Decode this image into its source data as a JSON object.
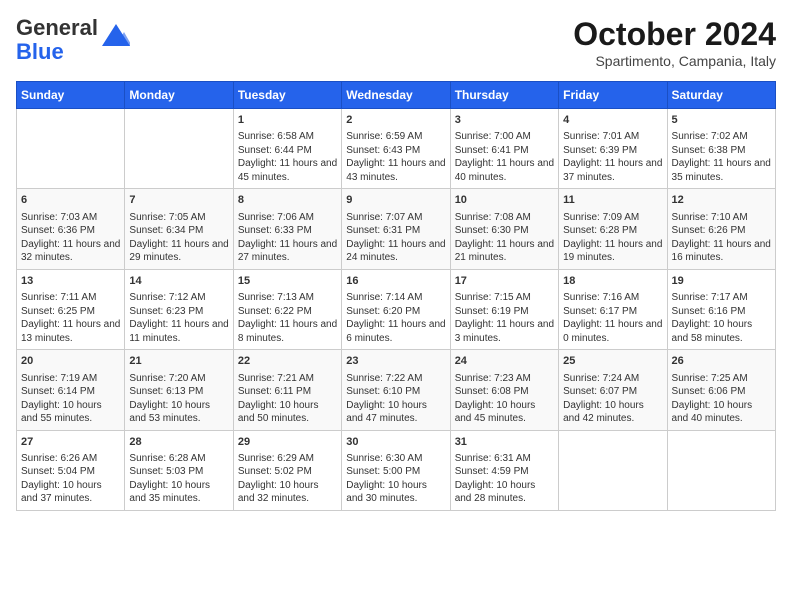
{
  "logo": {
    "general": "General",
    "blue": "Blue"
  },
  "title": "October 2024",
  "subtitle": "Spartimento, Campania, Italy",
  "days_of_week": [
    "Sunday",
    "Monday",
    "Tuesday",
    "Wednesday",
    "Thursday",
    "Friday",
    "Saturday"
  ],
  "weeks": [
    [
      {
        "day": "",
        "content": ""
      },
      {
        "day": "",
        "content": ""
      },
      {
        "day": "1",
        "content": "Sunrise: 6:58 AM\nSunset: 6:44 PM\nDaylight: 11 hours and 45 minutes."
      },
      {
        "day": "2",
        "content": "Sunrise: 6:59 AM\nSunset: 6:43 PM\nDaylight: 11 hours and 43 minutes."
      },
      {
        "day": "3",
        "content": "Sunrise: 7:00 AM\nSunset: 6:41 PM\nDaylight: 11 hours and 40 minutes."
      },
      {
        "day": "4",
        "content": "Sunrise: 7:01 AM\nSunset: 6:39 PM\nDaylight: 11 hours and 37 minutes."
      },
      {
        "day": "5",
        "content": "Sunrise: 7:02 AM\nSunset: 6:38 PM\nDaylight: 11 hours and 35 minutes."
      }
    ],
    [
      {
        "day": "6",
        "content": "Sunrise: 7:03 AM\nSunset: 6:36 PM\nDaylight: 11 hours and 32 minutes."
      },
      {
        "day": "7",
        "content": "Sunrise: 7:05 AM\nSunset: 6:34 PM\nDaylight: 11 hours and 29 minutes."
      },
      {
        "day": "8",
        "content": "Sunrise: 7:06 AM\nSunset: 6:33 PM\nDaylight: 11 hours and 27 minutes."
      },
      {
        "day": "9",
        "content": "Sunrise: 7:07 AM\nSunset: 6:31 PM\nDaylight: 11 hours and 24 minutes."
      },
      {
        "day": "10",
        "content": "Sunrise: 7:08 AM\nSunset: 6:30 PM\nDaylight: 11 hours and 21 minutes."
      },
      {
        "day": "11",
        "content": "Sunrise: 7:09 AM\nSunset: 6:28 PM\nDaylight: 11 hours and 19 minutes."
      },
      {
        "day": "12",
        "content": "Sunrise: 7:10 AM\nSunset: 6:26 PM\nDaylight: 11 hours and 16 minutes."
      }
    ],
    [
      {
        "day": "13",
        "content": "Sunrise: 7:11 AM\nSunset: 6:25 PM\nDaylight: 11 hours and 13 minutes."
      },
      {
        "day": "14",
        "content": "Sunrise: 7:12 AM\nSunset: 6:23 PM\nDaylight: 11 hours and 11 minutes."
      },
      {
        "day": "15",
        "content": "Sunrise: 7:13 AM\nSunset: 6:22 PM\nDaylight: 11 hours and 8 minutes."
      },
      {
        "day": "16",
        "content": "Sunrise: 7:14 AM\nSunset: 6:20 PM\nDaylight: 11 hours and 6 minutes."
      },
      {
        "day": "17",
        "content": "Sunrise: 7:15 AM\nSunset: 6:19 PM\nDaylight: 11 hours and 3 minutes."
      },
      {
        "day": "18",
        "content": "Sunrise: 7:16 AM\nSunset: 6:17 PM\nDaylight: 11 hours and 0 minutes."
      },
      {
        "day": "19",
        "content": "Sunrise: 7:17 AM\nSunset: 6:16 PM\nDaylight: 10 hours and 58 minutes."
      }
    ],
    [
      {
        "day": "20",
        "content": "Sunrise: 7:19 AM\nSunset: 6:14 PM\nDaylight: 10 hours and 55 minutes."
      },
      {
        "day": "21",
        "content": "Sunrise: 7:20 AM\nSunset: 6:13 PM\nDaylight: 10 hours and 53 minutes."
      },
      {
        "day": "22",
        "content": "Sunrise: 7:21 AM\nSunset: 6:11 PM\nDaylight: 10 hours and 50 minutes."
      },
      {
        "day": "23",
        "content": "Sunrise: 7:22 AM\nSunset: 6:10 PM\nDaylight: 10 hours and 47 minutes."
      },
      {
        "day": "24",
        "content": "Sunrise: 7:23 AM\nSunset: 6:08 PM\nDaylight: 10 hours and 45 minutes."
      },
      {
        "day": "25",
        "content": "Sunrise: 7:24 AM\nSunset: 6:07 PM\nDaylight: 10 hours and 42 minutes."
      },
      {
        "day": "26",
        "content": "Sunrise: 7:25 AM\nSunset: 6:06 PM\nDaylight: 10 hours and 40 minutes."
      }
    ],
    [
      {
        "day": "27",
        "content": "Sunrise: 6:26 AM\nSunset: 5:04 PM\nDaylight: 10 hours and 37 minutes."
      },
      {
        "day": "28",
        "content": "Sunrise: 6:28 AM\nSunset: 5:03 PM\nDaylight: 10 hours and 35 minutes."
      },
      {
        "day": "29",
        "content": "Sunrise: 6:29 AM\nSunset: 5:02 PM\nDaylight: 10 hours and 32 minutes."
      },
      {
        "day": "30",
        "content": "Sunrise: 6:30 AM\nSunset: 5:00 PM\nDaylight: 10 hours and 30 minutes."
      },
      {
        "day": "31",
        "content": "Sunrise: 6:31 AM\nSunset: 4:59 PM\nDaylight: 10 hours and 28 minutes."
      },
      {
        "day": "",
        "content": ""
      },
      {
        "day": "",
        "content": ""
      }
    ]
  ]
}
